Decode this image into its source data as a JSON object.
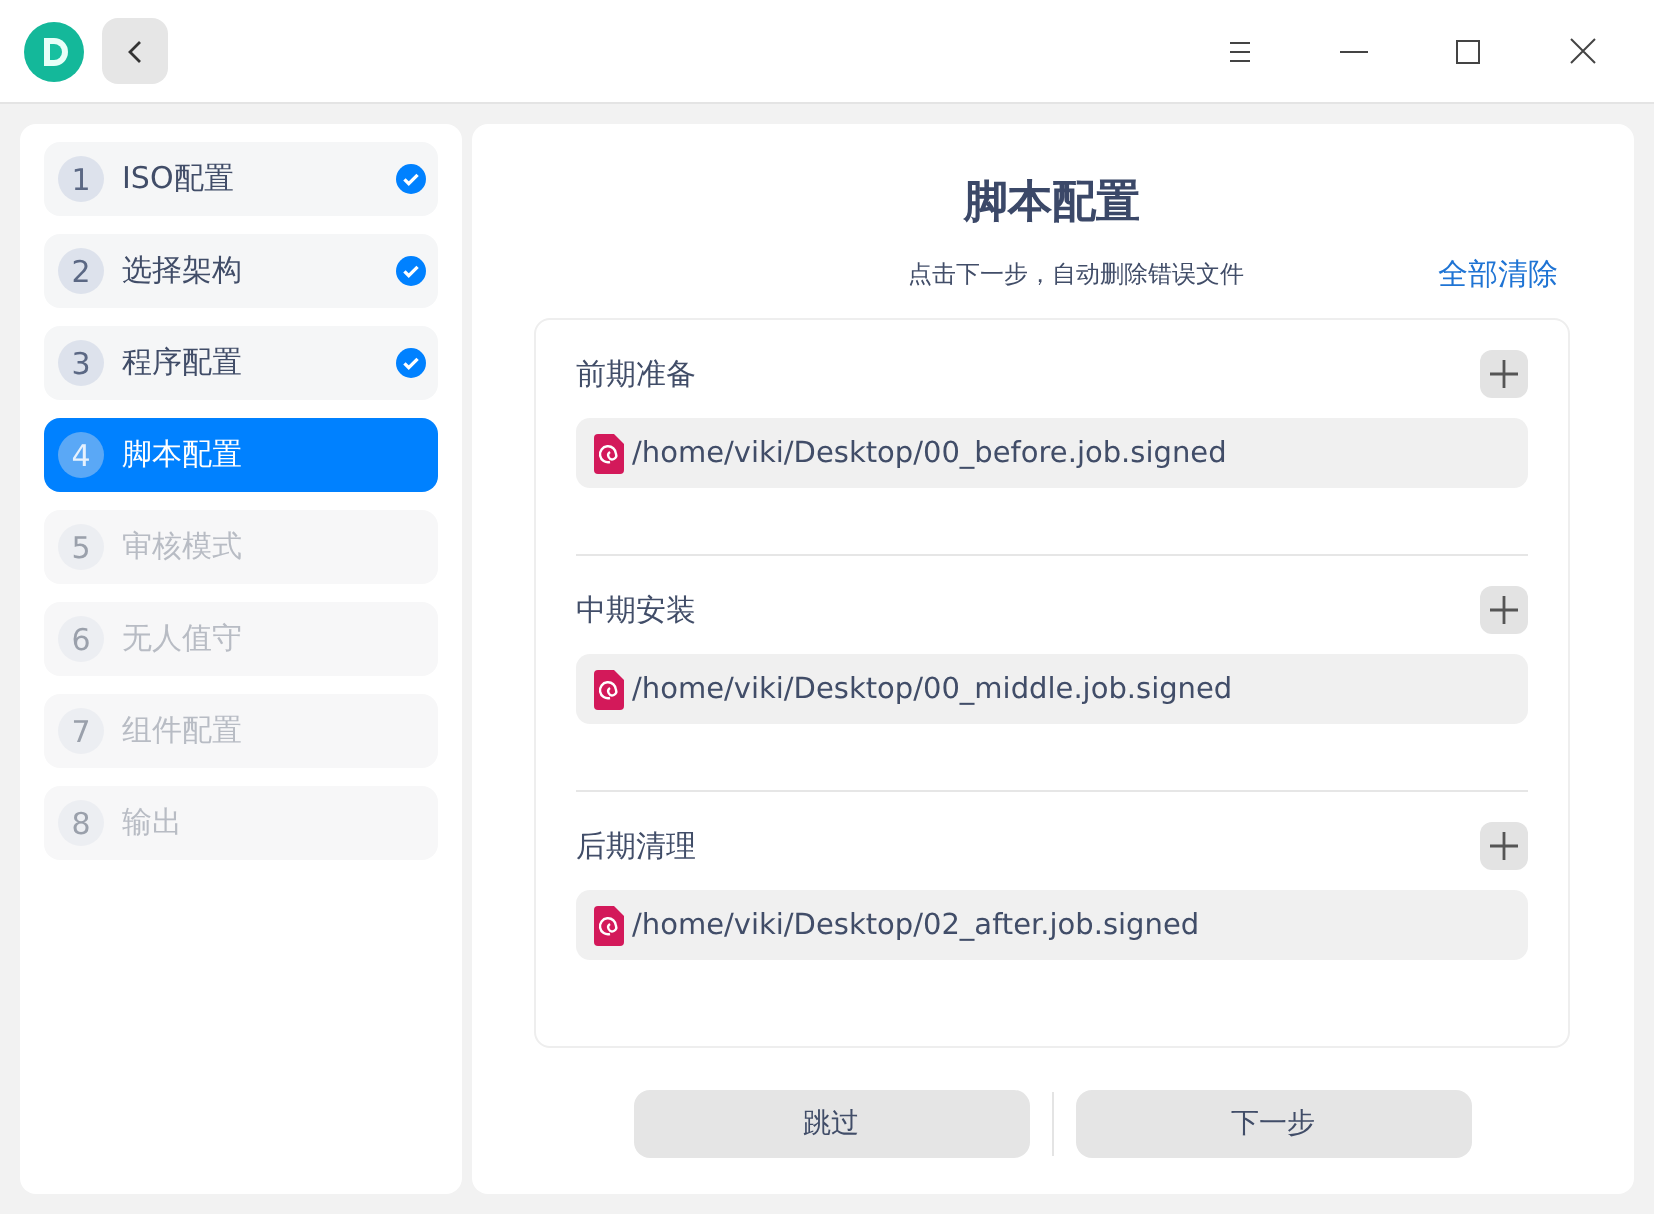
{
  "steps": [
    {
      "number": "1",
      "label": "ISO配置",
      "selected": false,
      "checked": true,
      "disabled": false
    },
    {
      "number": "2",
      "label": "选择架构",
      "selected": false,
      "checked": true,
      "disabled": false
    },
    {
      "number": "3",
      "label": "程序配置",
      "selected": false,
      "checked": true,
      "disabled": false
    },
    {
      "number": "4",
      "label": "脚本配置",
      "selected": true,
      "checked": false,
      "disabled": false
    },
    {
      "number": "5",
      "label": "审核模式",
      "selected": false,
      "checked": false,
      "disabled": true
    },
    {
      "number": "6",
      "label": "无人值守",
      "selected": false,
      "checked": false,
      "disabled": true
    },
    {
      "number": "7",
      "label": "组件配置",
      "selected": false,
      "checked": false,
      "disabled": true
    },
    {
      "number": "8",
      "label": "输出",
      "selected": false,
      "checked": false,
      "disabled": true
    }
  ],
  "page": {
    "title": "脚本配置",
    "hint": "点击下一步，自动删除错误文件",
    "clear_all": "全部清除"
  },
  "sections": [
    {
      "title": "前期准备",
      "files": [
        "/home/viki/Desktop/00_before.job.signed"
      ]
    },
    {
      "title": "中期安装",
      "files": [
        "/home/viki/Desktop/00_middle.job.signed"
      ]
    },
    {
      "title": "后期清理",
      "files": [
        "/home/viki/Desktop/02_after.job.signed"
      ]
    }
  ],
  "buttons": [
    "跳过",
    "下一步"
  ]
}
